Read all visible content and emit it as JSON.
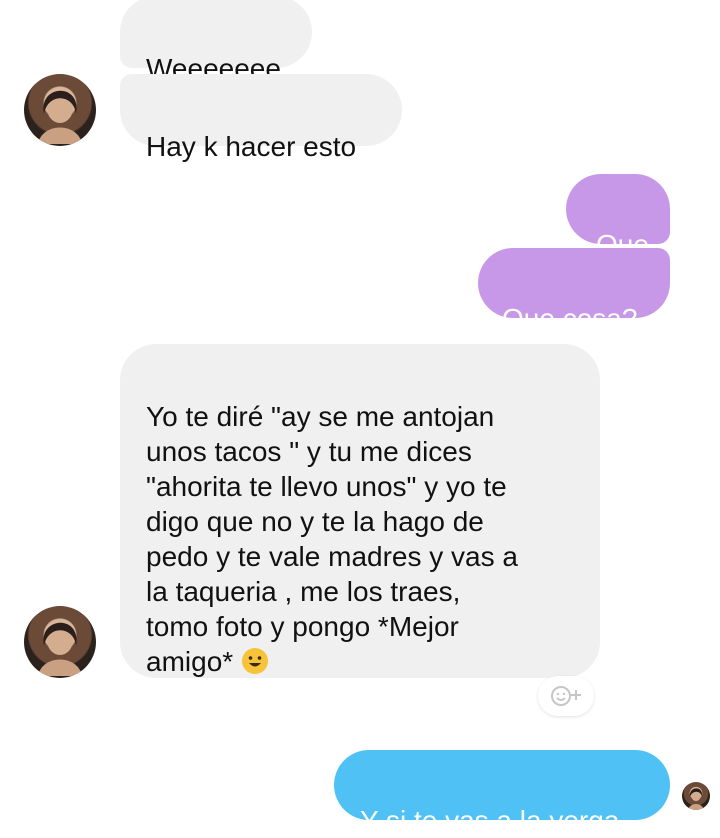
{
  "messages": {
    "m1": "Weeeeeee",
    "m2": "Hay k hacer esto",
    "m3": "Que",
    "m4": "Que cosa?",
    "m5": "Yo te diré \"ay se me antojan\nunos tacos \" y tu me dices\n\"ahorita te llevo unos\" y yo te\ndigo que no y te la hago de\npedo y te vale madres y vas a\nla taqueria , me los traes,\ntomo foto y pongo *Mejor\namigo*",
    "m6": "Y si te vas a la verga"
  },
  "icons": {
    "message_emoji": "smiling-face-icon",
    "reaction": "add-reaction-icon",
    "avatar": "profile-avatar"
  },
  "colors": {
    "incoming_bubble": "#f0f0f0",
    "outgoing_purple": "#c898e8",
    "outgoing_blue": "#4fc1f5"
  }
}
